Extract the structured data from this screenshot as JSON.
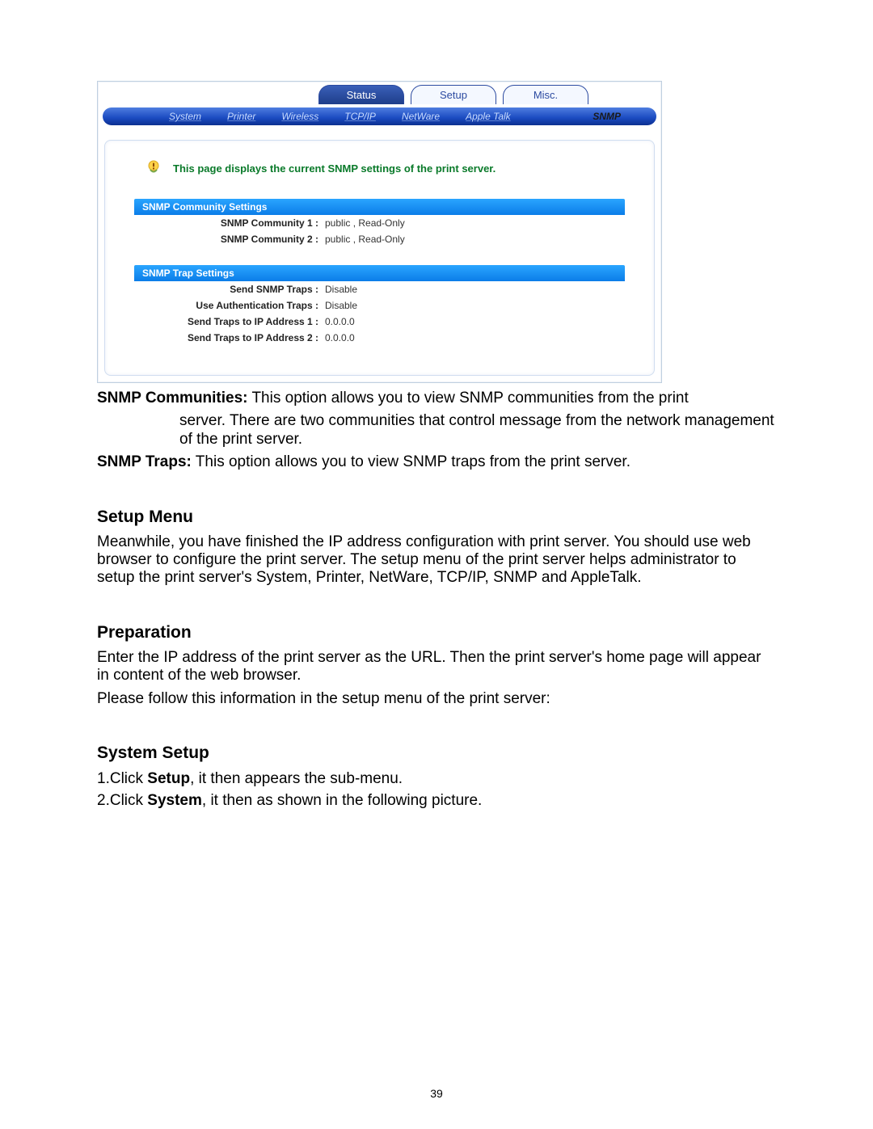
{
  "ui": {
    "top_tabs": {
      "status": "Status",
      "setup": "Setup",
      "misc": "Misc."
    },
    "nav": {
      "system": "System",
      "printer": "Printer",
      "wireless": "Wireless",
      "tcpip": "TCP/IP",
      "netware": "NetWare",
      "appletalk": "Apple Talk",
      "snmp": "SNMP"
    },
    "description": "This page displays the current SNMP settings of the print server.",
    "section1": {
      "title": "SNMP Community Settings",
      "rows": {
        "c1_label": "SNMP Community 1 :",
        "c1_value": "public , Read-Only",
        "c2_label": "SNMP Community 2 :",
        "c2_value": "public , Read-Only"
      }
    },
    "section2": {
      "title": "SNMP Trap Settings",
      "rows": {
        "r1_label": "Send SNMP Traps :",
        "r1_value": "Disable",
        "r2_label": "Use Authentication Traps :",
        "r2_value": "Disable",
        "r3_label": "Send Traps to IP Address 1 :",
        "r3_value": "0.0.0.0",
        "r4_label": "Send Traps to IP Address 2 :",
        "r4_value": "0.0.0.0"
      }
    }
  },
  "doc": {
    "p1_bold": "SNMP Communities:",
    "p1_a": " This option allows you to view SNMP communities from the print",
    "p1_b": "server. There are two communities that control message from the network management of the print server.",
    "p2_bold": "SNMP Traps:",
    "p2_rest": " This option allows you to view SNMP traps from the print server.",
    "h_setup": "Setup Menu",
    "p_setup": "Meanwhile, you have finished the IP address configuration with print server. You should  use web browser to configure the print server. The setup menu of the print server helps administrator to setup the print server's System, Printer, NetWare, TCP/IP, SNMP and AppleTalk.",
    "h_prep": "Preparation",
    "p_prep1": "Enter the IP address of the print server as the URL. Then the print server's home page will appear in content of the web browser.",
    "p_prep2": "Please follow this information in the setup menu of the print server:",
    "h_sys": "System Setup",
    "li1_a": "1.Click ",
    "li1_b": "Setup",
    "li1_c": ", it then appears the sub-menu.",
    "li2_a": "2.Click ",
    "li2_b": "System",
    "li2_c": ", it then as shown in the following picture.",
    "page_number": "39"
  }
}
